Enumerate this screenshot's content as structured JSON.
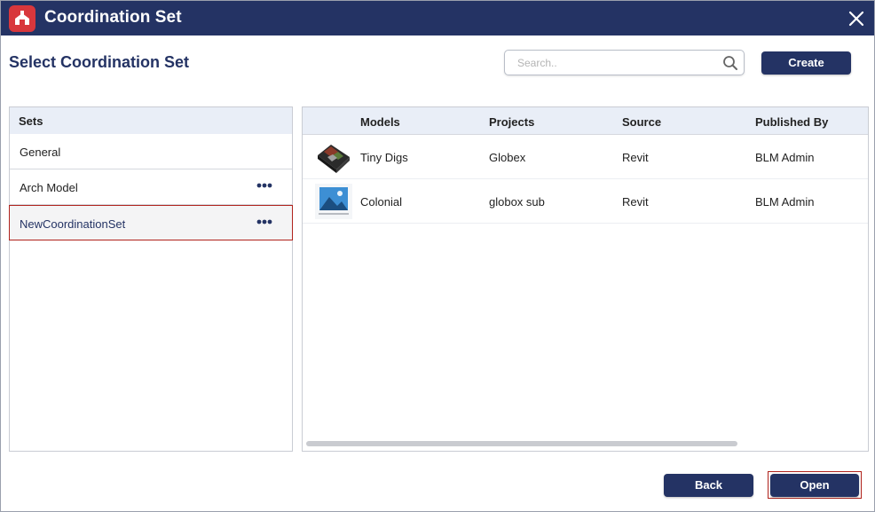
{
  "window": {
    "title": "Coordination Set"
  },
  "heading": "Select Coordination Set",
  "search": {
    "placeholder": "Search..",
    "value": ""
  },
  "buttons": {
    "create": "Create",
    "back": "Back",
    "open": "Open"
  },
  "sets": {
    "header": "Sets",
    "items": [
      {
        "label": "General",
        "has_menu": false,
        "selected": false
      },
      {
        "label": "Arch Model",
        "has_menu": true,
        "selected": false
      },
      {
        "label": "NewCoordinationSet",
        "has_menu": true,
        "selected": true
      }
    ]
  },
  "models": {
    "columns": [
      "Models",
      "Projects",
      "Source",
      "Published By"
    ],
    "rows": [
      {
        "thumbnail": "model-preview-image",
        "model": "Tiny Digs",
        "project": "Globex",
        "source": "Revit",
        "published_by": "BLM Admin"
      },
      {
        "thumbnail": "no-preview-image",
        "model": "Colonial",
        "project": "globox sub",
        "source": "Revit",
        "published_by": "BLM Admin"
      }
    ]
  },
  "colors": {
    "titlebar": "#243364",
    "accent": "#243364",
    "selection_border": "#b0231c",
    "logo": "#d8373c"
  },
  "icons": {
    "app": "app-logo-icon",
    "close": "close-icon",
    "search": "search-icon",
    "more": "more-horizontal-icon"
  }
}
